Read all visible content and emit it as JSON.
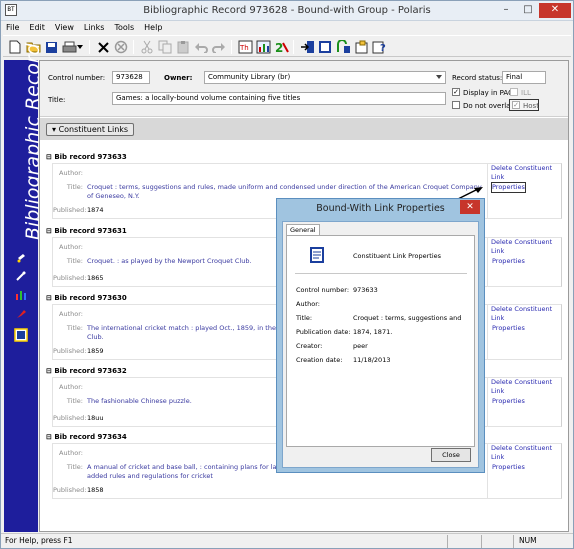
{
  "window": {
    "app_icon_text": "BT",
    "title": "Bibliographic Record 973628 - Bound-with Group - Polaris",
    "minimize": "–",
    "maximize": "□",
    "close": "✕"
  },
  "menu": [
    "File",
    "Edit",
    "View",
    "Links",
    "Tools",
    "Help"
  ],
  "toolbar": {
    "icons": [
      "new-icon",
      "open-icon",
      "save-icon",
      "print-icon",
      "dropdown-icon",
      "delete-icon",
      "cancel-icon",
      "cut-icon",
      "copy-icon",
      "paste-icon",
      "undo-icon",
      "redo-icon",
      "theme-icon",
      "chart-icon",
      "number-icon",
      "import-icon",
      "record-icon",
      "export-icon",
      "properties-icon",
      "help-icon"
    ]
  },
  "sidebar": {
    "vertical_title": "Bibliographic Record",
    "icons": [
      "hand-icon",
      "link-icon",
      "bar-icon",
      "tag-icon",
      "record-icon"
    ]
  },
  "header": {
    "control_number_label": "Control number:",
    "control_number": "973628",
    "owner_label": "Owner:",
    "owner": "Community Library (br)",
    "record_status_label": "Record status:",
    "record_status": "Final",
    "title_label": "Title:",
    "title": "Games: a locally-bound volume containing five titles",
    "display_in_pac_label": "Display in PAC",
    "ill_label": "ILL",
    "do_not_overlay_label": "Do not overlay",
    "host_label": "Host"
  },
  "constituent_links_label": "Constituent Links",
  "records": [
    {
      "heading": "Bib record 973633",
      "author_label": "Author:",
      "author": "",
      "title_label": "Title:",
      "title": "Croquet : terms, suggestions and rules, made uniform and condensed under direction of the American Croquet Company of Geneseo, N.Y.",
      "published_label": "Published:",
      "published": "1874",
      "delete_link": "Delete Constituent Link",
      "properties_link": "Properties"
    },
    {
      "heading": "Bib record 973631",
      "author_label": "Author:",
      "author": "",
      "title_label": "Title:",
      "title": "Croquet. : as played by the Newport Croquet Club.",
      "published_label": "Published:",
      "published": "1865",
      "delete_link": "Delete Constituent Link",
      "properties_link": "Properties"
    },
    {
      "heading": "Bib record 973630",
      "author_label": "Author:",
      "author": "",
      "title_label": "Title:",
      "title": "The international cricket match : played Oct., 1859, in the Elysia",
      "title_cont": "Club.",
      "published_label": "Published:",
      "published": "1859",
      "delete_link": "Delete Constituent Link",
      "properties_link": "Properties"
    },
    {
      "heading": "Bib record 973632",
      "author_label": "Author:",
      "author": "",
      "title_label": "Title:",
      "title": "The fashionable Chinese puzzle.",
      "published_label": "Published:",
      "published": "18uu",
      "delete_link": "Delete Constituent Link",
      "properties_link": "Properties"
    },
    {
      "heading": "Bib record 973634",
      "author_label": "Author:",
      "author": "",
      "title_label": "Title:",
      "title": "A manual of cricket and base ball, : containing plans for laying",
      "title_cont": "added rules and regulations for cricket",
      "published_label": "Published:",
      "published": "1858",
      "delete_link": "Delete Constituent Link",
      "properties_link": "Properties"
    }
  ],
  "dialog": {
    "title": "Bound-With Link Properties",
    "close_x": "✕",
    "tab": "General",
    "heading": "Constituent Link Properties",
    "fields": [
      {
        "label": "Control number:",
        "value": "973633"
      },
      {
        "label": "Author:",
        "value": ""
      },
      {
        "label": "Title:",
        "value": "Croquet : terms, suggestions and"
      },
      {
        "label": "Publication date:",
        "value": "1874, 1871."
      },
      {
        "label": "Creator:",
        "value": "peer"
      },
      {
        "label": "Creation date:",
        "value": "11/18/2013"
      }
    ],
    "close_button": "Close"
  },
  "status": {
    "help_text": "For Help, press F1",
    "num": "NUM"
  }
}
